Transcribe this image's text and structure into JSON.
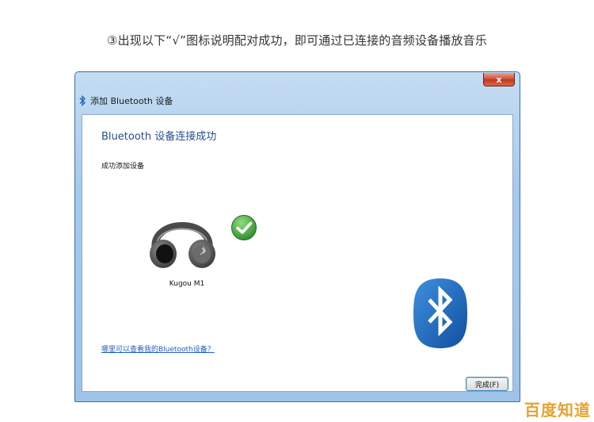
{
  "caption": "③出现以下“√”图标说明配对成功，即可通过已连接的音频设备播放音乐",
  "window": {
    "title": "添加 Bluetooth 设备",
    "close_label": "x",
    "heading": "Bluetooth 设备连接成功",
    "subtext": "成功添加设备",
    "device": {
      "name": "Kugou M1",
      "icon": "headphones-icon",
      "status_icon": "checkmark-icon"
    },
    "help_link": "哪里可以查看我的Bluetooth设备？",
    "finish_button": "完成(F)"
  },
  "watermark": "百度知道",
  "colors": {
    "heading": "#2a4d8a",
    "link": "#1f5fbf",
    "bluetooth_blue": "#1b63b3",
    "check_green": "#3da23d",
    "watermark": "#e7a232"
  }
}
